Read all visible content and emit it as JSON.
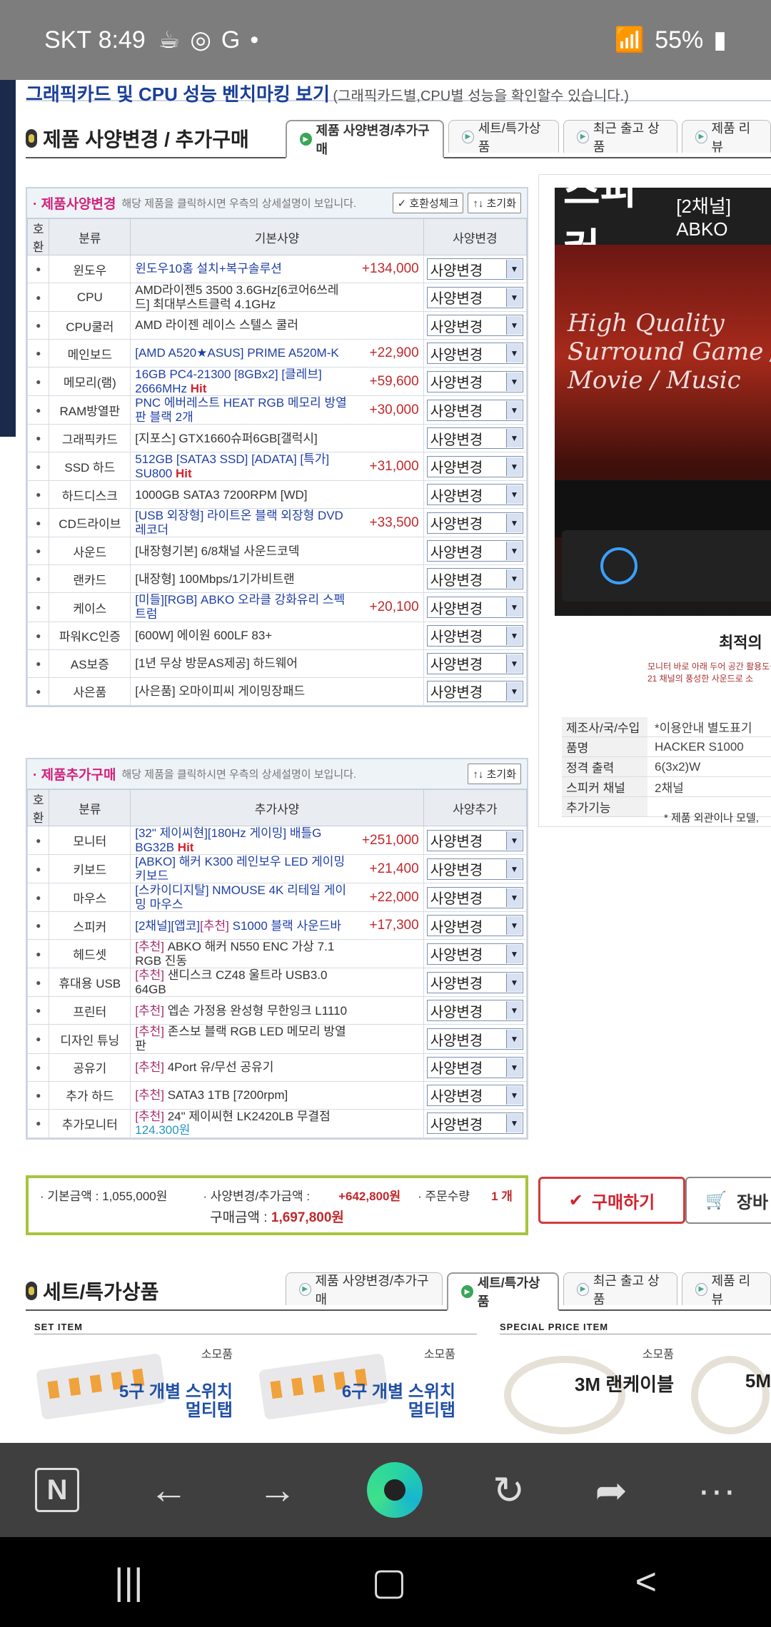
{
  "status_bar": {
    "carrier": "SKT",
    "time": "8:49",
    "battery": "55%"
  },
  "top_banner": {
    "title": "그래픽카드 및 CPU 성능 벤치마킹 보기",
    "note": "(그래픽카드별,CPU별 성능을 확인할수 있습니다.)"
  },
  "section1": {
    "title": "제품 사양변경 / 추가구매",
    "tabs": [
      "제품 사양변경/추가구매",
      "세트/특가상품",
      "최근 출고 상품",
      "제품 리뷰"
    ]
  },
  "spec_box": {
    "title": "· 제품사양변경",
    "desc": "해당 제품을 클릭하시면 우측의 상세설명이 보입니다.",
    "btn_compat": "✓ 호환성체크",
    "btn_reset": "↑↓ 초기화",
    "headers": [
      "호환",
      "분류",
      "기본사양",
      "사양변경"
    ],
    "select_label": "사양변경",
    "rows": [
      {
        "cat": "윈도우",
        "spec": "윈도우10홈 설치+복구솔루션",
        "price": "+134,000"
      },
      {
        "cat": "CPU",
        "spec": "AMD라이젠5 3500 3.6GHz[6코어6쓰레드] 최대부스트클럭 4.1GHz",
        "price": ""
      },
      {
        "cat": "CPU쿨러",
        "spec": "AMD 라이젠 레이스 스텔스 쿨러",
        "price": ""
      },
      {
        "cat": "메인보드",
        "spec": "[AMD A520★ASUS] PRIME A520M-K",
        "price": "+22,900"
      },
      {
        "cat": "메모리(램)",
        "spec": "16GB PC4-21300 [8GBx2] [클레브] 2666MHz Hit",
        "price": "+59,600"
      },
      {
        "cat": "RAM방열판",
        "spec": "PNC 에버레스트 HEAT RGB 메모리 방열판 블랙 2개",
        "price": "+30,000"
      },
      {
        "cat": "그래픽카드",
        "spec": "[지포스] GTX1660슈퍼6GB[갤럭시]",
        "price": ""
      },
      {
        "cat": "SSD 하드",
        "spec": "512GB [SATA3 SSD] [ADATA] [특가] SU800 Hit",
        "price": "+31,000"
      },
      {
        "cat": "하드디스크",
        "spec": "1000GB SATA3 7200RPM [WD]",
        "price": ""
      },
      {
        "cat": "CD드라이브",
        "spec": "[USB 외장형] 라이트온 블랙 외장형 DVD레코더",
        "price": "+33,500"
      },
      {
        "cat": "사운드",
        "spec": "[내장형기본] 6/8채널 사운드코덱",
        "price": ""
      },
      {
        "cat": "랜카드",
        "spec": "[내장형] 100Mbps/1기가비트랜",
        "price": ""
      },
      {
        "cat": "케이스",
        "spec": "[미들][RGB] ABKO 오라클 강화유리 스펙트럼",
        "price": "+20,100"
      },
      {
        "cat": "파워KC인증",
        "spec": "[600W] 에이원 600LF 83+",
        "price": ""
      },
      {
        "cat": "AS보증",
        "spec": "[1년 무상 방문AS제공] 하드웨어",
        "price": ""
      },
      {
        "cat": "사은품",
        "spec": "[사은품] 오마이피씨 게이밍장패드",
        "price": ""
      }
    ]
  },
  "add_box": {
    "title": "· 제품추가구매",
    "desc": "해당 제품을 클릭하시면 우측의 상세설명이 보입니다.",
    "btn_reset": "↑↓ 초기화",
    "headers": [
      "호환",
      "분류",
      "추가사양",
      "사양추가"
    ],
    "select_label": "사양변경",
    "rows": [
      {
        "cat": "모니터",
        "spec": "[32\" 제이씨현][180Hz 게이밍] 배틀G BG32B Hit",
        "price": "+251,000"
      },
      {
        "cat": "키보드",
        "spec": "[ABKO] 해커 K300 레인보우 LED 게이밍 키보드",
        "price": "+21,400"
      },
      {
        "cat": "마우스",
        "spec": "[스카이디지탈] NMOUSE 4K 리테일 게이밍 마우스",
        "price": "+22,000"
      },
      {
        "cat": "스피커",
        "spec": "[2채널][앱코][추천] S1000 블랙 사운드바",
        "price": "+17,300"
      },
      {
        "cat": "헤드셋",
        "spec": "[추천] ABKO 해커 N550 ENC 가상 7.1 RGB 진동",
        "price": ""
      },
      {
        "cat": "휴대용 USB",
        "spec": "[추천] 샌디스크 CZ48 울트라 USB3.0 64GB",
        "price": ""
      },
      {
        "cat": "프린터",
        "spec": "[추천] 엡손 가정용 완성형 무한잉크 L1110",
        "price": ""
      },
      {
        "cat": "디자인 튜닝",
        "spec": "[추천] 존스보 블랙 RGB LED 메모리 방열판",
        "price": ""
      },
      {
        "cat": "공유기",
        "spec": "[추천] 4Port 유/무선 공유기",
        "price": ""
      },
      {
        "cat": "추가 하드",
        "spec": "[추천] SATA3 1TB [7200rpm]",
        "price": ""
      },
      {
        "cat": "추가모니터",
        "spec": "[추천] 24\" 제이씨현 LK2420LB 무결점 124.300원",
        "price": ""
      }
    ]
  },
  "right_panel": {
    "title_big": "스피커",
    "title_small": "[2채널] ABKO",
    "script": "High Quality Surround Game / Movie / Music",
    "caption": "최적의",
    "caption_small": "모니터 바로 아래 두어 공간 활용도를 21 채널의 풍성한 사운드로 소",
    "spec_labels": [
      "제조사/국/수입",
      "품명",
      "정격 출력",
      "스피커 채널",
      "추가기능"
    ],
    "spec_values": [
      "*이용안내 별도표기",
      "HACKER S1000",
      "6(3x2)W",
      "2채널",
      ""
    ],
    "note": "* 제품 외관이나 모델,"
  },
  "summary": {
    "base_label": "· 기본금액 : 1,055,000원",
    "change_label": "· 사양변경/추가금액 :",
    "change_value": "+642,800원",
    "qty_label": "· 주문수량",
    "qty_value": "1 개",
    "total_label": "구매금액 :",
    "total_value": "1,697,800원"
  },
  "buttons": {
    "buy": "구매하기",
    "cart": "장바"
  },
  "section2": {
    "title": "세트/특가상품",
    "tabs": [
      "제품 사양변경/추가구매",
      "세트/특가상품",
      "최근 출고 상품",
      "제품 리뷰"
    ]
  },
  "set_items": {
    "set_label": "SET ITEM",
    "special_label": "SPECIAL PRICE ITEM",
    "cards": [
      {
        "tag": "소모품",
        "name": "5구 개별 스위치 멀티탭"
      },
      {
        "tag": "소모품",
        "name": "6구 개별 스위치 멀티탭"
      },
      {
        "tag": "소모품",
        "name": "3M 랜케이블"
      },
      {
        "tag": "",
        "name": "5M"
      }
    ]
  }
}
